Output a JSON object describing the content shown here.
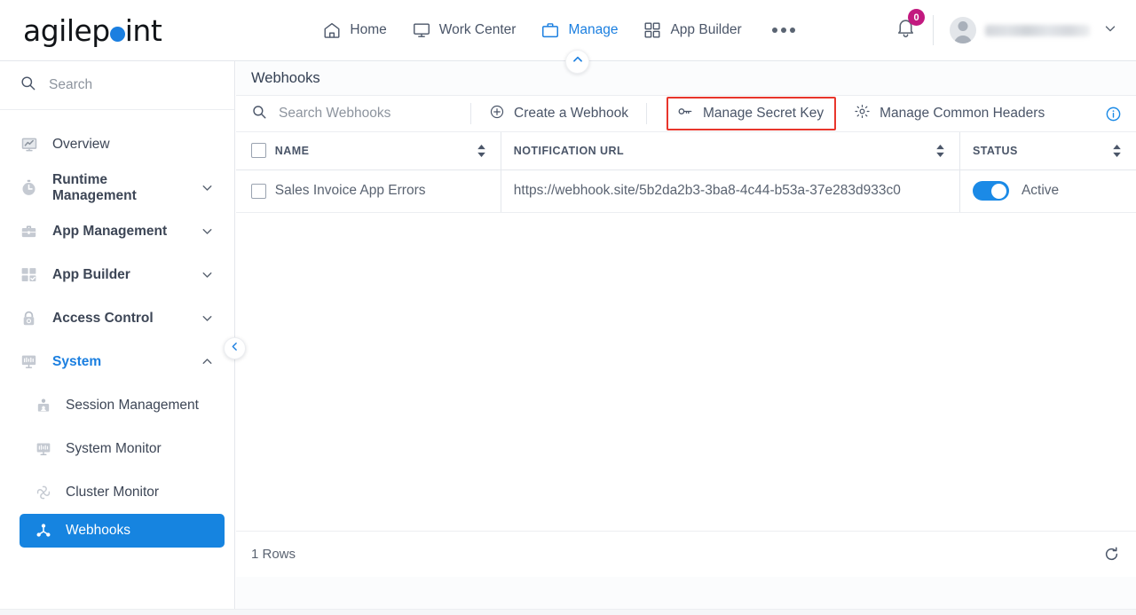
{
  "brand": {
    "logo_text_before": "agilep",
    "logo_dot": "o",
    "logo_text_after": "int",
    "accent_color": "#1b7fe0",
    "highlight_color": "#e8362c",
    "badge_color": "#c2197f"
  },
  "header": {
    "nav": [
      {
        "label": "Home",
        "icon": "home-icon",
        "active": false
      },
      {
        "label": "Work Center",
        "icon": "monitor-icon",
        "active": false
      },
      {
        "label": "Manage",
        "icon": "briefcase-icon",
        "active": true
      },
      {
        "label": "App Builder",
        "icon": "grid-icon",
        "active": false
      }
    ],
    "overflow_icon": "ellipsis-icon",
    "notifications": {
      "icon": "bell-icon",
      "count": "0"
    },
    "user": {
      "name": "",
      "avatar_icon": "avatar-icon",
      "chevron": "chevron-down-icon"
    }
  },
  "sidebar": {
    "search": {
      "placeholder": "Search",
      "value": "",
      "icon": "search-icon"
    },
    "items": [
      {
        "label": "Overview",
        "icon": "chart-monitor-icon",
        "expandable": false
      },
      {
        "label": "Runtime Management",
        "icon": "stopwatch-icon",
        "expandable": true,
        "expanded": false
      },
      {
        "label": "App Management",
        "icon": "briefcase-icon",
        "expandable": true,
        "expanded": false
      },
      {
        "label": "App Builder",
        "icon": "grid-check-icon",
        "expandable": true,
        "expanded": false
      },
      {
        "label": "Access Control",
        "icon": "lock-icon",
        "expandable": true,
        "expanded": false
      },
      {
        "label": "System",
        "icon": "system-monitor-icon",
        "expandable": true,
        "expanded": true
      }
    ],
    "system_children": [
      {
        "label": "Session Management",
        "icon": "user-card-icon",
        "active": false
      },
      {
        "label": "System Monitor",
        "icon": "system-monitor-icon",
        "active": false
      },
      {
        "label": "Cluster Monitor",
        "icon": "cluster-icon",
        "active": false
      },
      {
        "label": "Webhooks",
        "icon": "webhook-node-icon",
        "active": true
      }
    ],
    "collapse_icon": "chevron-left-icon"
  },
  "main": {
    "page_title": "Webhooks",
    "panel_collapse_icon": "chevron-up-icon",
    "toolbar": {
      "search": {
        "placeholder": "Search Webhooks",
        "value": "",
        "icon": "search-icon"
      },
      "create_label": "Create a Webhook",
      "create_icon": "plus-circle-icon",
      "secret_key_label": "Manage Secret Key",
      "secret_key_icon": "key-icon",
      "secret_key_highlighted": true,
      "common_headers_label": "Manage Common Headers",
      "common_headers_icon": "gear-icon",
      "info_icon": "info-circle-icon"
    },
    "table": {
      "columns": [
        {
          "key": "checkbox",
          "label": "",
          "sortable": false
        },
        {
          "key": "name",
          "label": "NAME",
          "sortable": true
        },
        {
          "key": "url",
          "label": "NOTIFICATION URL",
          "sortable": true
        },
        {
          "key": "status",
          "label": "STATUS",
          "sortable": true
        }
      ],
      "rows": [
        {
          "selected": false,
          "name": "Sales Invoice App Errors",
          "url": "https://webhook.site/5b2da2b3-3ba8-4c44-b53a-37e283d933c0",
          "status_label": "Active",
          "status_on": true
        }
      ]
    },
    "footer": {
      "rows_count": "1 Rows",
      "refresh_icon": "refresh-icon"
    }
  }
}
